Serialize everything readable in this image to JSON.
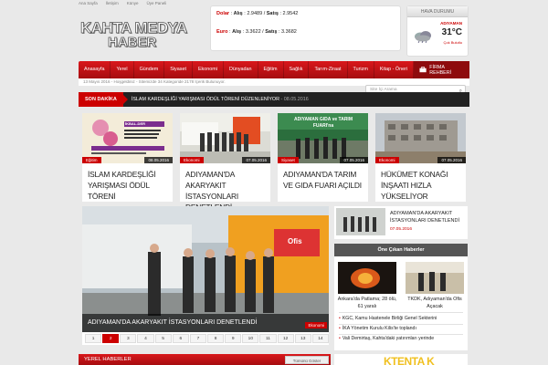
{
  "topbar": {
    "links": [
      "Ana Sayfa",
      "İletişim",
      "Künye",
      "Üye Paneli"
    ]
  },
  "logo": {
    "line1": "KAHTA MEDYA",
    "line2": "HABER"
  },
  "currency": {
    "dolar": {
      "name": "Dolar",
      "buy_label": "Alış",
      "buy": "2.9489",
      "sell_label": "Satış",
      "sell": "2.9542"
    },
    "euro": {
      "name": "Euro",
      "buy_label": "Alış",
      "buy": "3.3622",
      "sell_label": "Satış",
      "sell": "3.3682"
    }
  },
  "weather": {
    "title": "HAVA DURUMU",
    "city": "ADIYAMAN",
    "temp": "31°C",
    "desc": "Çok Bulutlu"
  },
  "nav": {
    "items": [
      "Anasayfa",
      "Yerel",
      "Gündem",
      "Siyaset",
      "Ekonomi",
      "Dünyadan",
      "Eğitim",
      "Sağlık",
      "Tarım-Ziraat",
      "Turizm",
      "Kitap - Öneri"
    ],
    "firma": "FİRMA REHBERİ"
  },
  "infobar": {
    "text": "13 Mayıs 2016 - Hoşgeldiniz - Sitemizde 34 Kategoride 2178 İçerik Bulunuyor."
  },
  "search": {
    "placeholder": "Site İçi Arama"
  },
  "breaking": {
    "tag": "SON DAKİKA",
    "headline": "İSLAM KARDEŞLİĞİ YARIŞMASI ÖDÜL TÖRENİ DÜZENLENİYOR",
    "date": "- 08.05.2016"
  },
  "cards": [
    {
      "category": "Eğitim",
      "date": "08.05.2016",
      "title": "İSLAM KARDEŞLİĞİ YARIŞMASI ÖDÜL TÖRENİ"
    },
    {
      "category": "Ekonomi",
      "date": "07.05.2016",
      "title": "ADIYAMAN'DA AKARYAKIT İSTASYONLARI DENETLENDİ"
    },
    {
      "category": "Siyaset",
      "date": "07.05.2016",
      "title": "ADIYAMAN'DA TARIM VE GIDA FUARI AÇILDI"
    },
    {
      "category": "Ekonomi",
      "date": "07.05.2016",
      "title": "HÜKÜMET KONAĞI İNŞAATI HIZLA YÜKSELİYOR"
    }
  ],
  "card_image_text": {
    "ikbal": "İKBAL-DER",
    "fair": "ADIYAMAN GIDA ve TARIM FUARI'na"
  },
  "slider": {
    "caption": "ADIYAMAN'DA AKARYAKIT İSTASYONLARI DENETLENDİ",
    "category": "Ekonomi",
    "pages": [
      "1",
      "2",
      "3",
      "4",
      "5",
      "6",
      "7",
      "8",
      "9",
      "10",
      "11",
      "12",
      "13",
      "14"
    ],
    "active_page": "2",
    "sign_text": "Ofis"
  },
  "side_top": {
    "title": "ADIYAMAN'DA AKARYAKIT İSTASYONLARI DENETLENDİ",
    "date": "07.05.2016"
  },
  "featured": {
    "heading": "Öne Çıkan Haberler",
    "items": [
      {
        "caption": "Ankara'da Patlama; 28 ölü, 61 yaralı"
      },
      {
        "caption": "TKDK, Adıyaman'da Ofis Açacak"
      }
    ],
    "list": [
      "KGC, Kamu Hastenele Birliği Genel Sekterini",
      "İKA Yönetim Kurulu Kilis'te toplandı",
      "Vali Demirtaş, Kahta'daki yatırımları yerinde"
    ]
  },
  "local": {
    "heading": "YEREL HABERLER",
    "show_all": "Tümünü Göster"
  },
  "ad": {
    "text": "KTENTA K"
  },
  "colors": {
    "accent": "#c4121a",
    "dark": "#222222"
  }
}
